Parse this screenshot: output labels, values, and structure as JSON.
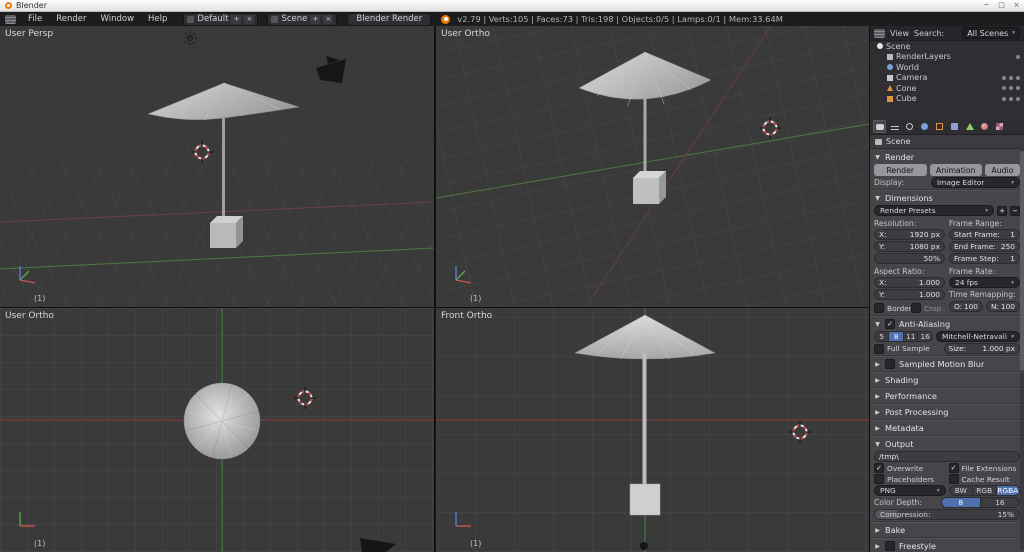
{
  "colors": {
    "accent_blue": "#4e71ad",
    "header_bg": "#1d1d1d",
    "viewport_bg": "#3a3a3a",
    "panel_bg": "#46464a",
    "axis_green": "#4e7a3f",
    "axis_red": "#7a3a3a",
    "blender_orange": "#e87d0d"
  },
  "titlebar": {
    "title": "Blender",
    "minimize": "─",
    "maximize": "□",
    "close": "×"
  },
  "menubar": {
    "menus": [
      {
        "label": "File"
      },
      {
        "label": "Render"
      },
      {
        "label": "Window"
      },
      {
        "label": "Help"
      }
    ],
    "layout": {
      "value": "Default"
    },
    "scene": {
      "value": "Scene"
    },
    "engine": {
      "value": "Blender Render"
    },
    "stats": "v2.79 | Verts:105 | Faces:73 | Tris:198 | Objects:0/5 | Lamps:0/1 | Mem:33.64M"
  },
  "viewports": {
    "top_left": {
      "label": "User Persp",
      "layer": "(1)"
    },
    "top_right": {
      "label": "User Ortho",
      "layer": "(1)"
    },
    "bottom_left": {
      "label": "User Ortho",
      "layer": "(1)"
    },
    "bottom_right": {
      "label": "Front Ortho",
      "layer": "(1)"
    }
  },
  "outliner": {
    "view": "View",
    "search": "Search:",
    "filter": "All Scenes",
    "items": [
      {
        "label": "Scene"
      },
      {
        "label": "RenderLayers"
      },
      {
        "label": "World"
      },
      {
        "label": "Camera"
      },
      {
        "label": "Cone"
      },
      {
        "label": "Cube"
      }
    ]
  },
  "properties": {
    "breadcrumb": "Scene",
    "render": {
      "title": "Render",
      "render_button": "Render",
      "animation_button": "Animation",
      "audio_button": "Audio",
      "display_label": "Display:",
      "display_value": "Image Editor"
    },
    "dimensions": {
      "title": "Dimensions",
      "presets": "Render Presets",
      "resolution_label": "Resolution:",
      "frame_range_label": "Frame Range:",
      "res_x_label": "X:",
      "res_x": "1920 px",
      "res_y_label": "Y:",
      "res_y": "1080 px",
      "res_percent": "50%",
      "start_label": "Start Frame:",
      "start": "1",
      "end_label": "End Frame:",
      "end": "250",
      "step_label": "Frame Step:",
      "step": "1",
      "aspect_label": "Aspect Ratio:",
      "rate_label": "Frame Rate:",
      "aspect_x_label": "X:",
      "aspect_x": "1.000",
      "aspect_y_label": "Y:",
      "aspect_y": "1.000",
      "fps": "24 fps",
      "border": "Border",
      "crop": "Crop",
      "remap_label": "Time Remapping:",
      "remap_old_label": "O:",
      "remap_old": "100",
      "remap_new_label": "N:",
      "remap_new": "100"
    },
    "anti_aliasing": {
      "title": "Anti-Aliasing",
      "samples": [
        "5",
        "8",
        "11",
        "16"
      ],
      "selected_sample": "8",
      "filter": "Mitchell-Netravali",
      "full_sample": "Full Sample",
      "size_label": "Size:",
      "size": "1.000 px"
    },
    "sections": {
      "motion_blur": "Sampled Motion Blur",
      "shading": "Shading",
      "performance": "Performance",
      "post_processing": "Post Processing",
      "metadata": "Metadata",
      "bake": "Bake",
      "freestyle": "Freestyle"
    },
    "output": {
      "title": "Output",
      "path": "/tmp\\",
      "overwrite": "Overwrite",
      "file_extensions": "File Extensions",
      "placeholders": "Placeholders",
      "cache_result": "Cache Result",
      "format": "PNG",
      "bw": "BW",
      "rgb": "RGB",
      "rgba": "RGBA",
      "depth_label": "Color Depth:",
      "depth_8": "8",
      "depth_16": "16",
      "compression_label": "Compression:",
      "compression": "15%"
    }
  },
  "icons": {
    "open": "▼",
    "closed": "▶",
    "check": "✓",
    "drop": "▾",
    "plus": "+",
    "minus": "−",
    "close": "×",
    "left": "◂",
    "right": "▸"
  }
}
